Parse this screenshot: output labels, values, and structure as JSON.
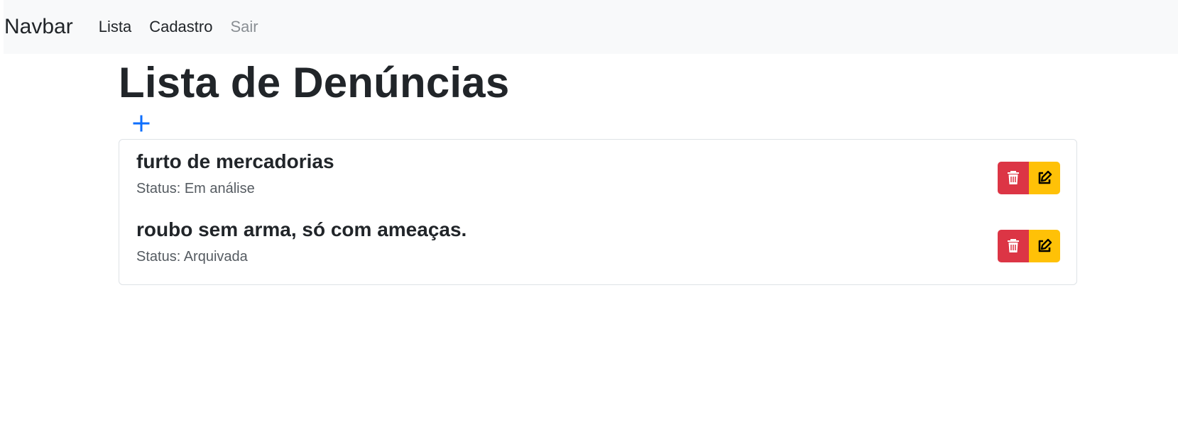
{
  "navbar": {
    "brand": "Navbar",
    "links": [
      {
        "label": "Lista"
      },
      {
        "label": "Cadastro"
      },
      {
        "label": "Sair"
      }
    ]
  },
  "page": {
    "title": "Lista de Denúncias"
  },
  "icons": {
    "add": "plus-icon",
    "delete": "trash-icon",
    "edit": "edit-icon"
  },
  "colors": {
    "navbar_bg": "#f8f9fa",
    "add_icon": "#0d6efd",
    "danger": "#dc3545",
    "warning": "#ffc107"
  },
  "complaints": [
    {
      "title": "furto de mercadorias",
      "status": "Status: Em análise"
    },
    {
      "title": "roubo sem arma, só com ameaças.",
      "status": "Status: Arquivada"
    }
  ]
}
